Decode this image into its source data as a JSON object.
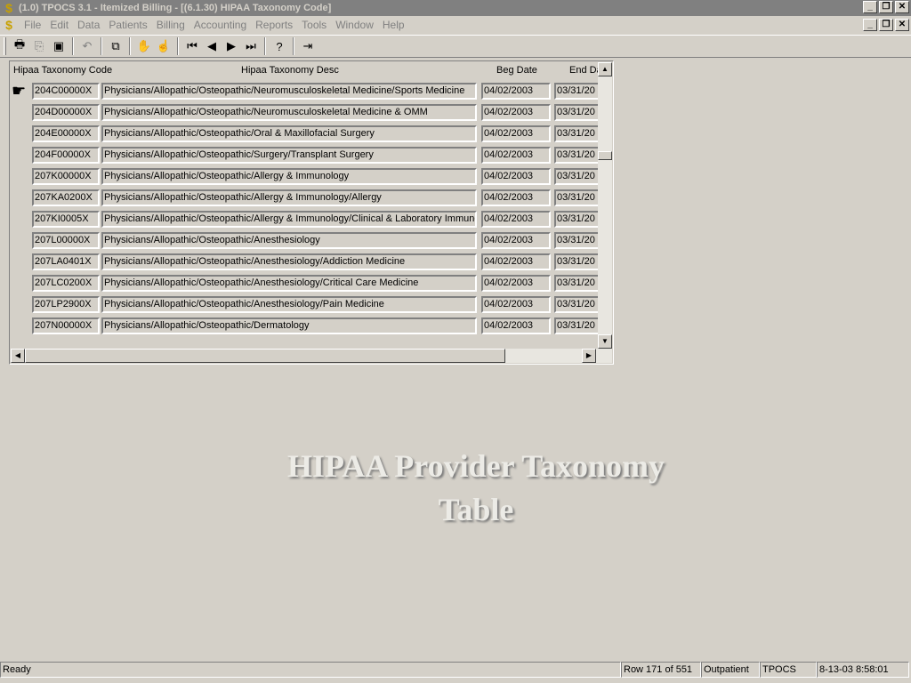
{
  "window": {
    "title": "(1.0) TPOCS 3.1 - Itemized Billing - [(6.1.30) HIPAA Taxonomy Code]"
  },
  "menu": [
    "File",
    "Edit",
    "Data",
    "Patients",
    "Billing",
    "Accounting",
    "Reports",
    "Tools",
    "Window",
    "Help"
  ],
  "toolbar": {
    "buttons": [
      {
        "name": "print-icon",
        "glyph": "🖶"
      },
      {
        "name": "print-preview-icon",
        "glyph": "⎘"
      },
      {
        "name": "save-icon",
        "glyph": "▣"
      },
      {
        "name": "undo-icon",
        "glyph": "↶"
      },
      {
        "name": "duplicate-icon",
        "glyph": "⧉"
      },
      {
        "name": "hand-icon",
        "glyph": "✋"
      },
      {
        "name": "hand-search-icon",
        "glyph": "☝"
      },
      {
        "name": "first-record-icon",
        "glyph": "⏮"
      },
      {
        "name": "previous-record-icon",
        "glyph": "◀"
      },
      {
        "name": "next-record-icon",
        "glyph": "▶"
      },
      {
        "name": "last-record-icon",
        "glyph": "⏭"
      },
      {
        "name": "help-icon",
        "glyph": "?"
      },
      {
        "name": "exit-icon",
        "glyph": "⇥"
      }
    ]
  },
  "grid": {
    "headers": {
      "code": "Hipaa Taxonomy Code",
      "desc": "Hipaa Taxonomy Desc",
      "beg": "Beg Date",
      "end": "End Da"
    },
    "rows": [
      {
        "code": "204C00000X",
        "desc": "Physicians/Allopathic/Osteopathic/Neuromusculoskeletal Medicine/Sports Medicine",
        "beg": "04/02/2003",
        "end": "03/31/20"
      },
      {
        "code": "204D00000X",
        "desc": "Physicians/Allopathic/Osteopathic/Neuromusculoskeletal Medicine & OMM",
        "beg": "04/02/2003",
        "end": "03/31/20"
      },
      {
        "code": "204E00000X",
        "desc": "Physicians/Allopathic/Osteopathic/Oral & Maxillofacial Surgery",
        "beg": "04/02/2003",
        "end": "03/31/20"
      },
      {
        "code": "204F00000X",
        "desc": "Physicians/Allopathic/Osteopathic/Surgery/Transplant Surgery",
        "beg": "04/02/2003",
        "end": "03/31/20"
      },
      {
        "code": "207K00000X",
        "desc": "Physicians/Allopathic/Osteopathic/Allergy & Immunology",
        "beg": "04/02/2003",
        "end": "03/31/20"
      },
      {
        "code": "207KA0200X",
        "desc": "Physicians/Allopathic/Osteopathic/Allergy & Immunology/Allergy",
        "beg": "04/02/2003",
        "end": "03/31/20"
      },
      {
        "code": "207KI0005X",
        "desc": "Physicians/Allopathic/Osteopathic/Allergy & Immunology/Clinical & Laboratory Immunolog",
        "beg": "04/02/2003",
        "end": "03/31/20"
      },
      {
        "code": "207L00000X",
        "desc": "Physicians/Allopathic/Osteopathic/Anesthesiology",
        "beg": "04/02/2003",
        "end": "03/31/20"
      },
      {
        "code": "207LA0401X",
        "desc": "Physicians/Allopathic/Osteopathic/Anesthesiology/Addiction Medicine",
        "beg": "04/02/2003",
        "end": "03/31/20"
      },
      {
        "code": "207LC0200X",
        "desc": "Physicians/Allopathic/Osteopathic/Anesthesiology/Critical Care Medicine",
        "beg": "04/02/2003",
        "end": "03/31/20"
      },
      {
        "code": "207LP2900X",
        "desc": "Physicians/Allopathic/Osteopathic/Anesthesiology/Pain Medicine",
        "beg": "04/02/2003",
        "end": "03/31/20"
      },
      {
        "code": "207N00000X",
        "desc": "Physicians/Allopathic/Osteopathic/Dermatology",
        "beg": "04/02/2003",
        "end": "03/31/20"
      }
    ]
  },
  "watermark": {
    "line1": "HIPAA Provider Taxonomy",
    "line2": "Table"
  },
  "status": {
    "ready": "Ready",
    "row": "Row 171 of 551",
    "mode": "Outpatient",
    "app": "TPOCS",
    "datetime": "8-13-03 8:58:01"
  },
  "colors": {
    "background": "#d4d0c8",
    "titlebar_inactive": "#808080",
    "watermark": "#ecebe6"
  }
}
